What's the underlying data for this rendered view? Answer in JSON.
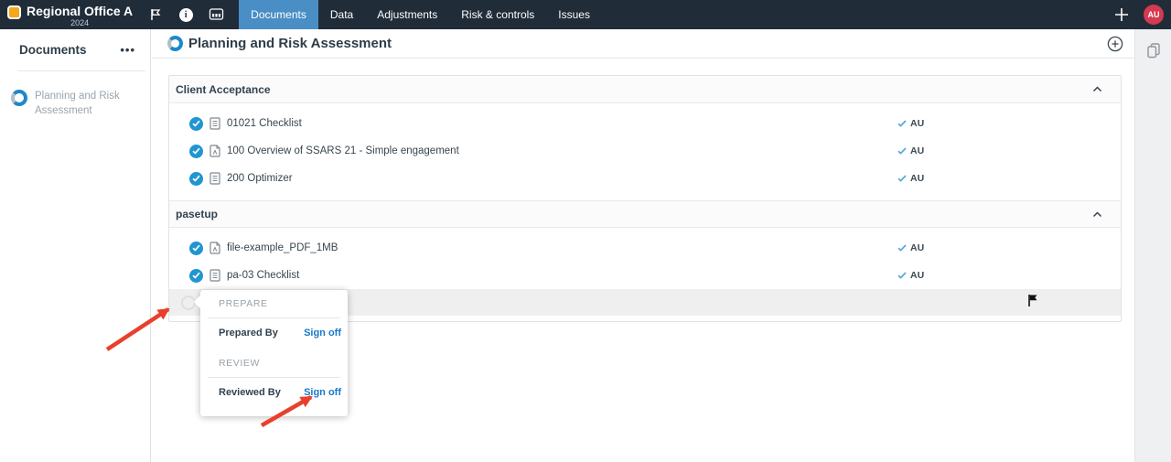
{
  "topbar": {
    "entity_name": "Regional Office A",
    "entity_year": "2024",
    "tabs": [
      {
        "label": "Documents"
      },
      {
        "label": "Data"
      },
      {
        "label": "Adjustments"
      },
      {
        "label": "Risk & controls"
      },
      {
        "label": "Issues"
      }
    ],
    "active_tab": "Documents",
    "avatar_initials": "AU"
  },
  "sidebar": {
    "title": "Documents",
    "items": [
      {
        "label": "Planning and Risk Assessment"
      }
    ]
  },
  "main": {
    "title": "Planning and Risk Assessment",
    "sections": [
      {
        "title": "Client Acceptance",
        "items": [
          {
            "name": "01021 Checklist",
            "icon": "checklist",
            "signoff_initials": "AU"
          },
          {
            "name": "100 Overview of SSARS 21 - Simple engagement",
            "icon": "pdf",
            "signoff_initials": "AU"
          },
          {
            "name": "200 Optimizer",
            "icon": "checklist",
            "signoff_initials": "AU"
          }
        ]
      },
      {
        "title": "pasetup",
        "items": [
          {
            "name": "file-example_PDF_1MB",
            "icon": "pdf",
            "signoff_initials": "AU"
          },
          {
            "name": "pa-03 Checklist",
            "icon": "checklist",
            "signoff_initials": "AU"
          }
        ]
      }
    ]
  },
  "signoff_popup": {
    "prepare_section": "PREPARE",
    "prepared_by_label": "Prepared By",
    "prepared_signoff_link": "Sign off",
    "review_section": "REVIEW",
    "reviewed_by_label": "Reviewed By",
    "reviewed_signoff_link": "Sign off"
  },
  "icons": {
    "more": "•••"
  },
  "colors": {
    "topbar_bg": "#212c39",
    "active_tab_blue": "#4a8ec6",
    "brand_orange": "#f5a81c",
    "avatar_red": "#d43a52",
    "status_blue": "#2095d2",
    "link_blue": "#1878c8",
    "arrow_red": "#e8402c"
  }
}
